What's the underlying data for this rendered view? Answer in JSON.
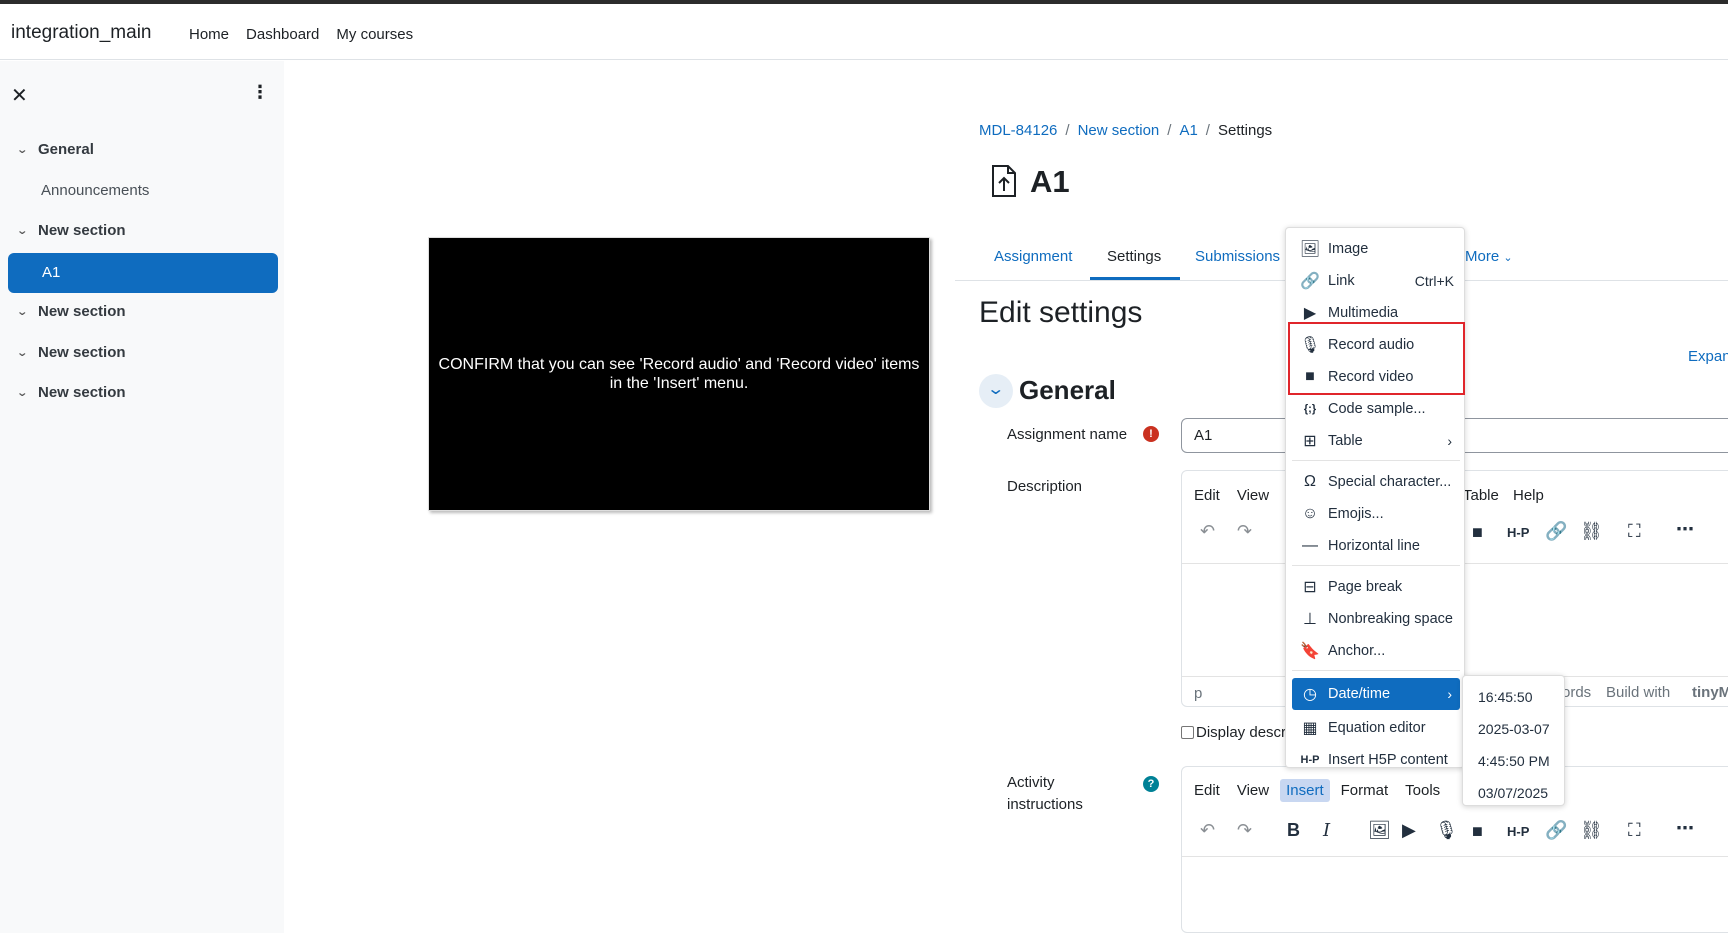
{
  "navbar": {
    "brand": "integration_main",
    "links": [
      "Home",
      "Dashboard",
      "My courses"
    ]
  },
  "sidebar": {
    "sections": [
      {
        "label": "General"
      },
      {
        "label": "New section"
      },
      {
        "label": "New section"
      },
      {
        "label": "New section"
      },
      {
        "label": "New section"
      }
    ],
    "sub_items": [
      "Announcements",
      "A1"
    ],
    "active_item": "A1"
  },
  "overlay_message": "CONFIRM that you can see 'Record audio' and 'Record video' items in the 'Insert' menu.",
  "breadcrumb": [
    "MDL-84126",
    "New section",
    "A1",
    "Settings"
  ],
  "page": {
    "title": "A1",
    "heading": "Edit settings",
    "expand_label": "Expan",
    "section_title": "General"
  },
  "tabs": [
    "Assignment",
    "Settings",
    "Submissions",
    "More"
  ],
  "active_tab": "Settings",
  "form": {
    "assignment_name_label": "Assignment name",
    "assignment_name_value": "A1",
    "description_label": "Description",
    "display_description_label": "Display descr",
    "activity_instructions_label_1": "Activity",
    "activity_instructions_label_2": "instructions"
  },
  "editor1": {
    "menubar": [
      "Edit",
      "View"
    ],
    "menubar_right": [
      "Table",
      "Help"
    ],
    "status_left": "p",
    "status_words": "ords",
    "status_build": "Build with",
    "status_brand": "tinyM"
  },
  "editor2": {
    "menubar": [
      "Edit",
      "View",
      "Insert",
      "Format",
      "Tools"
    ]
  },
  "insert_menu": {
    "items": [
      {
        "label": "Image",
        "icon": "image-icon",
        "glyph": "🖼"
      },
      {
        "label": "Link",
        "icon": "link-icon",
        "glyph": "🔗",
        "shortcut": "Ctrl+K"
      },
      {
        "label": "Multimedia",
        "icon": "multimedia-icon",
        "glyph": "▶"
      },
      {
        "label": "Record audio",
        "icon": "microphone-icon",
        "glyph": "🎙"
      },
      {
        "label": "Record video",
        "icon": "video-camera-icon",
        "glyph": "■"
      },
      {
        "label": "Code sample...",
        "icon": "code-sample-icon",
        "glyph": "{;}"
      },
      {
        "label": "Table",
        "icon": "table-icon",
        "glyph": "⊞"
      },
      {
        "label": "Special character...",
        "icon": "omega-icon",
        "glyph": "Ω"
      },
      {
        "label": "Emojis...",
        "icon": "emoji-icon",
        "glyph": "☺"
      },
      {
        "label": "Horizontal line",
        "icon": "horizontal-line-icon",
        "glyph": "—"
      },
      {
        "label": "Page break",
        "icon": "page-break-icon",
        "glyph": "⊟"
      },
      {
        "label": "Nonbreaking space",
        "icon": "nonbreaking-space-icon",
        "glyph": "⊥"
      },
      {
        "label": "Anchor...",
        "icon": "bookmark-icon",
        "glyph": "🔖"
      },
      {
        "label": "Date/time",
        "icon": "clock-icon",
        "glyph": "◷"
      },
      {
        "label": "Equation editor",
        "icon": "equation-icon",
        "glyph": "▦"
      },
      {
        "label": "Insert H5P content",
        "icon": "h5p-icon",
        "glyph": "H-P"
      }
    ]
  },
  "datetime_submenu": [
    "16:45:50",
    "2025-03-07",
    "4:45:50 PM",
    "03/07/2025"
  ],
  "colors": {
    "primary": "#0f6cbf",
    "highlight_border": "#e0252b",
    "required": "#ca3120",
    "help": "#008196"
  }
}
